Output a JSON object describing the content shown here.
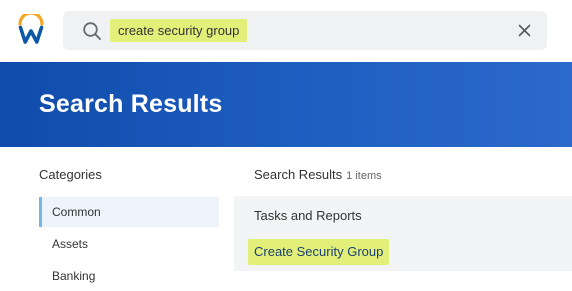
{
  "header": {
    "logo_icon": "workday-logo",
    "search": {
      "icon": "search-icon",
      "query": "create security group",
      "clear_icon": "close-icon"
    }
  },
  "banner": {
    "title": "Search Results"
  },
  "categories": {
    "heading": "Categories",
    "items": [
      {
        "label": "Common",
        "active": true
      },
      {
        "label": "Assets",
        "active": false
      },
      {
        "label": "Banking",
        "active": false
      }
    ]
  },
  "results": {
    "heading": "Search Results",
    "count": "1 items",
    "groups": [
      {
        "title": "Tasks and Reports",
        "items": [
          {
            "label": "Create Security Group"
          }
        ]
      }
    ]
  },
  "colors": {
    "banner_start": "#0f4cab",
    "banner_end": "#2b6acb",
    "highlight": "#e2f07a",
    "logo_orange": "#f5a623",
    "logo_blue": "#0c57a6"
  }
}
